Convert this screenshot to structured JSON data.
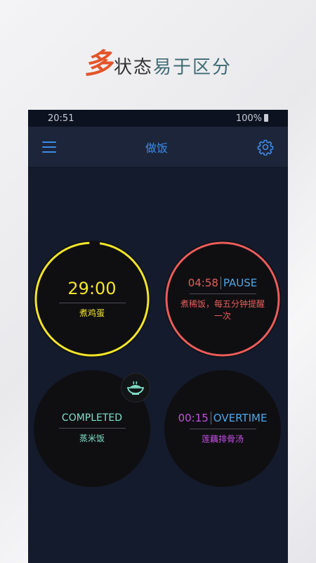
{
  "banner": {
    "big_char": "多",
    "mid_text": "状态",
    "end_text": "易于区分"
  },
  "status_bar": {
    "time": "20:51",
    "battery": "100%"
  },
  "toolbar": {
    "title": "做饭"
  },
  "timers": [
    {
      "time": "29:00",
      "state": "",
      "name": "煮鸡蛋",
      "color": "#f2e52a",
      "progress": 0.97
    },
    {
      "time": "04:58",
      "state": "PAUSE",
      "name": "煮稀饭，每五分钟提醒一次",
      "color": "#ea5d5b",
      "state_color": "#4ea6e8"
    },
    {
      "time": "",
      "state": "COMPLETED",
      "name": "蒸米饭",
      "color": "#7fe0c8",
      "icon": "bowl-icon"
    },
    {
      "time": "00:15",
      "state": "OVERTIME",
      "name": "莲藕排骨汤",
      "color": "#c84ee8",
      "state_color": "#4ea6e8"
    }
  ]
}
